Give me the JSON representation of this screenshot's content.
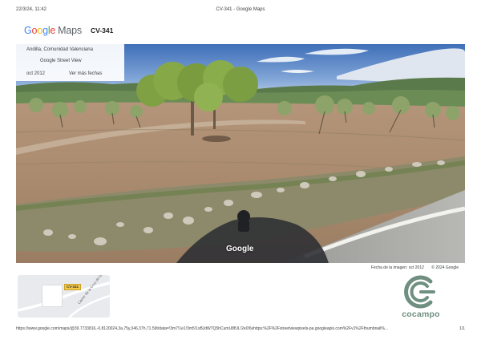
{
  "print_header": {
    "datetime": "22/3/24, 11:42",
    "title": "CV-341 - Google Maps"
  },
  "header": {
    "logo_google": [
      "G",
      "o",
      "o",
      "g",
      "l",
      "e"
    ],
    "logo_maps": "Maps",
    "road_title": "CV-341"
  },
  "info_panel": {
    "location": "Andilla, Comunidad Valenciana",
    "street_view_link": "Google Street View",
    "capture_date": "oct 2012",
    "more_dates": "Ver más fechas"
  },
  "street_view": {
    "watermark": "Google",
    "credits": [
      "Fecha de la imagen: oct 2012",
      "© 2024 Google"
    ]
  },
  "minimap": {
    "road_shield": "CV-341",
    "street_label": "Carrer de la Cruz de Gracia"
  },
  "sponsor": {
    "name": "cocampo",
    "color": "#6f8f80"
  },
  "print_footer": {
    "url": "https://www.google.com/maps/@39.7733816,-0.8120024,3a,75y,346.37h,71.59t/data=!3m7!1e1!3m5!1sBJdW7Q5hCumU8fUL!2e0!6shttps:%2F%2Fstreetviewpixels-pa.googleapis.com%2Fv1%2Fthumbnail%...",
    "page": "1/1"
  },
  "colors": {
    "google_blue": "#4285F4",
    "google_red": "#EA4335",
    "google_yellow": "#FBBC05",
    "google_green": "#34A853"
  }
}
